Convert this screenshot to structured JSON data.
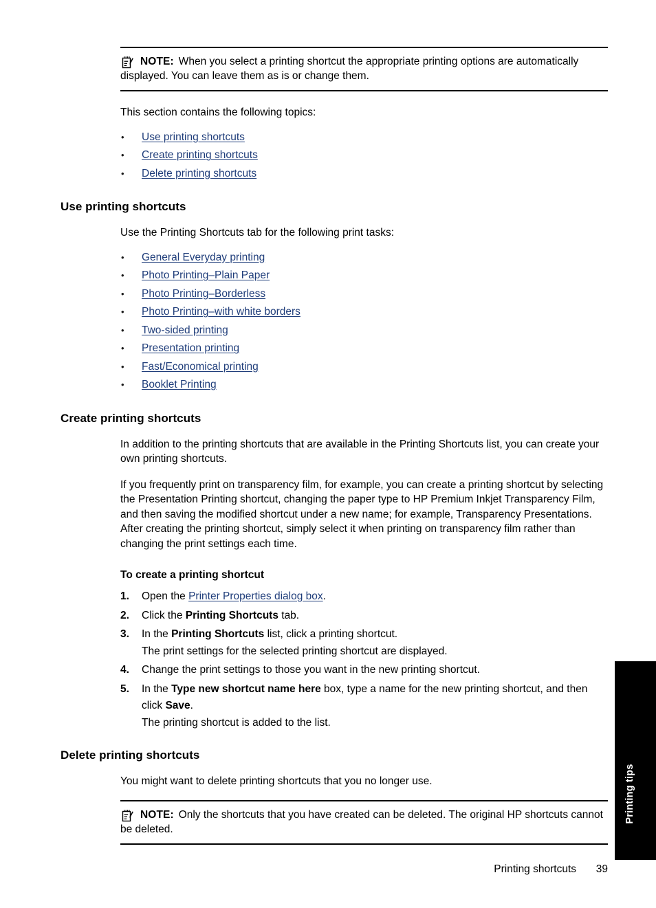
{
  "note_top": {
    "icon": "note-pad-pencil-icon",
    "label": "NOTE:",
    "text": "When you select a printing shortcut the appropriate printing options are automatically displayed. You can leave them as is or change them."
  },
  "intro": {
    "lead": "This section contains the following topics:",
    "topics": [
      "Use printing shortcuts",
      "Create printing shortcuts",
      "Delete printing shortcuts"
    ]
  },
  "use_section": {
    "heading": "Use printing shortcuts",
    "lead": "Use the Printing Shortcuts tab for the following print tasks:",
    "tasks": [
      "General Everyday printing",
      "Photo Printing–Plain Paper",
      "Photo Printing–Borderless",
      "Photo Printing–with white borders",
      "Two-sided printing",
      "Presentation printing",
      "Fast/Economical printing",
      "Booklet Printing"
    ]
  },
  "create_section": {
    "heading": "Create printing shortcuts",
    "para1": "In addition to the printing shortcuts that are available in the Printing Shortcuts list, you can create your own printing shortcuts.",
    "para2": "If you frequently print on transparency film, for example, you can create a printing shortcut by selecting the Presentation Printing shortcut, changing the paper type to HP Premium Inkjet Transparency Film, and then saving the modified shortcut under a new name; for example, Transparency Presentations. After creating the printing shortcut, simply select it when printing on transparency film rather than changing the print settings each time.",
    "procedure_heading": "To create a printing shortcut",
    "steps": [
      {
        "num": "1.",
        "pre": "Open the ",
        "link": "Printer Properties dialog box",
        "post": "."
      },
      {
        "num": "2.",
        "pre": "Click the ",
        "bold": "Printing Shortcuts",
        "post": " tab."
      },
      {
        "num": "3.",
        "pre": "In the ",
        "bold": "Printing Shortcuts",
        "post": " list, click a printing shortcut.",
        "result": "The print settings for the selected printing shortcut are displayed."
      },
      {
        "num": "4.",
        "pre": "Change the print settings to those you want in the new printing shortcut."
      },
      {
        "num": "5.",
        "pre": "In the ",
        "bold": "Type new shortcut name here",
        "mid": " box, type a name for the new printing shortcut, and then click ",
        "bold2": "Save",
        "post": ".",
        "result": "The printing shortcut is added to the list."
      }
    ]
  },
  "delete_section": {
    "heading": "Delete printing shortcuts",
    "para1": "You might want to delete printing shortcuts that you no longer use."
  },
  "note_bottom": {
    "icon": "note-pad-pencil-icon",
    "label": "NOTE:",
    "text": "Only the shortcuts that you have created can be deleted. The original HP shortcuts cannot be deleted."
  },
  "side_tab": {
    "label": "Printing tips",
    "background": "#000000",
    "color": "#ffffff"
  },
  "footer": {
    "title": "Printing shortcuts",
    "page": "39"
  },
  "colors": {
    "link": "#1F3D7A",
    "text": "#000000",
    "rule": "#000000"
  }
}
